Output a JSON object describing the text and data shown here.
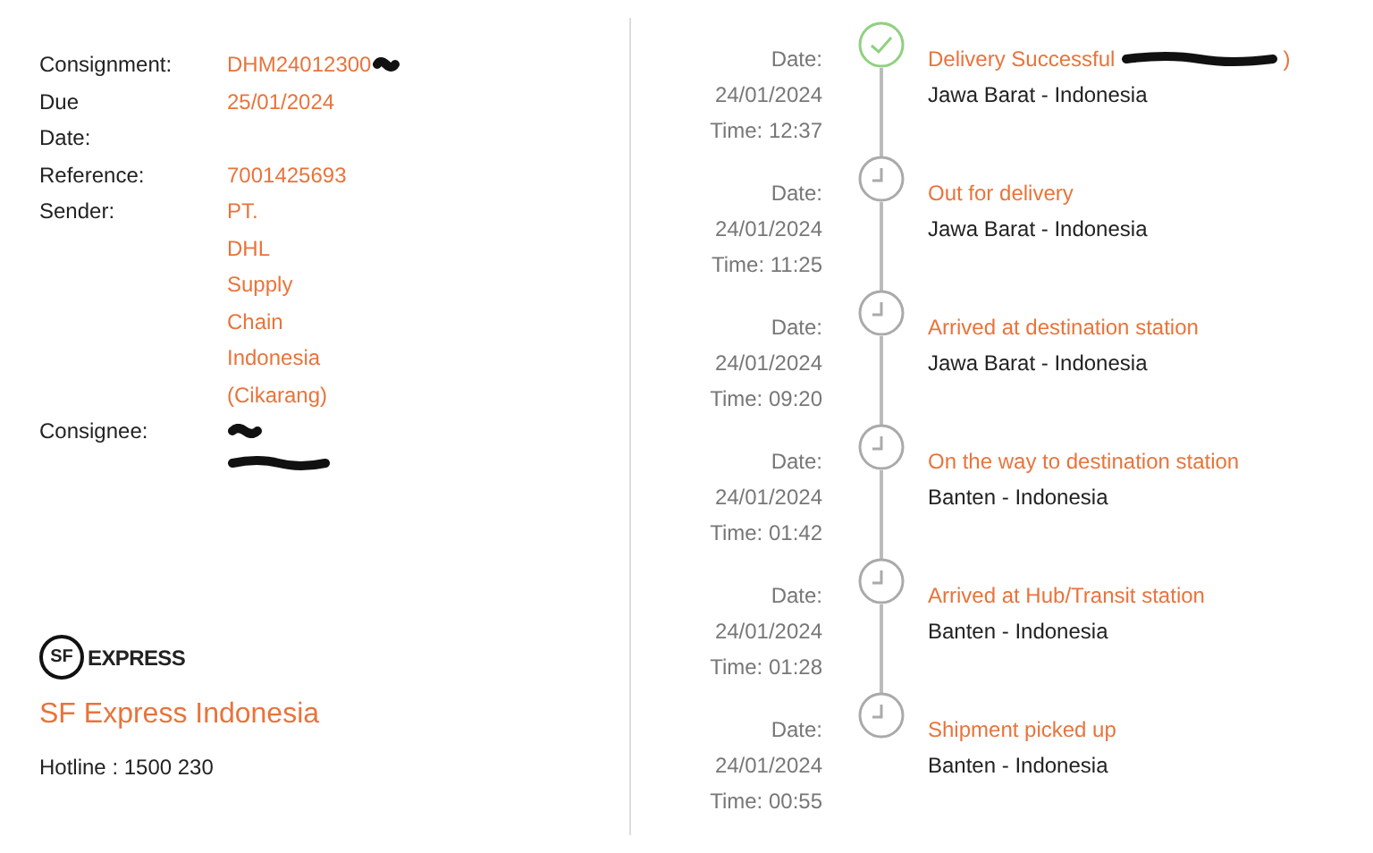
{
  "details": [
    {
      "label": "Consignment:",
      "values": [
        "DHM24012300"
      ],
      "redacted": true
    },
    {
      "label": "Due",
      "values": [
        "25/01/2024"
      ],
      "redacted": false
    },
    {
      "label": "Date:",
      "redacted": false
    },
    {
      "label": "Reference:",
      "values": [
        "7001425693"
      ],
      "redacted": false
    },
    {
      "label": "Sender:",
      "values": [
        "PT.",
        "DHL",
        "Supply",
        "Chain",
        "Indonesia",
        "(Cikarang)"
      ],
      "redacted": false
    },
    {
      "label": "Consignee:",
      "redacted": true
    }
  ],
  "company": {
    "logo_text": "EXPRESS",
    "logo_mark": "SF",
    "name": "SF Express Indonesia",
    "hotline": "Hotline : 1500 230"
  },
  "events": [
    {
      "kind": "delivered",
      "date_label": "Date:",
      "date": "24/01/2024",
      "time": "Time: 12:37",
      "status": "Delivery Successful",
      "redacted": true,
      "status_end": ")",
      "location": "Jawa Barat - Indonesia"
    },
    {
      "kind": "pending",
      "date_label": "Date:",
      "date": "24/01/2024",
      "time": "Time: 11:25",
      "status": "Out for delivery",
      "redacted": false,
      "location": "Jawa Barat - Indonesia"
    },
    {
      "kind": "pending",
      "date_label": "Date:",
      "date": "24/01/2024",
      "time": "Time: 09:20",
      "status": "Arrived at destination station",
      "redacted": false,
      "location": "Jawa Barat - Indonesia"
    },
    {
      "kind": "pending",
      "date_label": "Date:",
      "date": "24/01/2024",
      "time": "Time: 01:42",
      "status": "On the way to destination station",
      "redacted": false,
      "location": "Banten - Indonesia"
    },
    {
      "kind": "pending",
      "date_label": "Date:",
      "date": "24/01/2024",
      "time": "Time: 01:28",
      "status": "Arrived at Hub/Transit station",
      "redacted": false,
      "location": "Banten - Indonesia"
    },
    {
      "kind": "pending",
      "date_label": "Date:",
      "date": "24/01/2024",
      "time": "Time: 00:55",
      "status": "Shipment picked up",
      "redacted": false,
      "location": "Banten - Indonesia"
    }
  ]
}
